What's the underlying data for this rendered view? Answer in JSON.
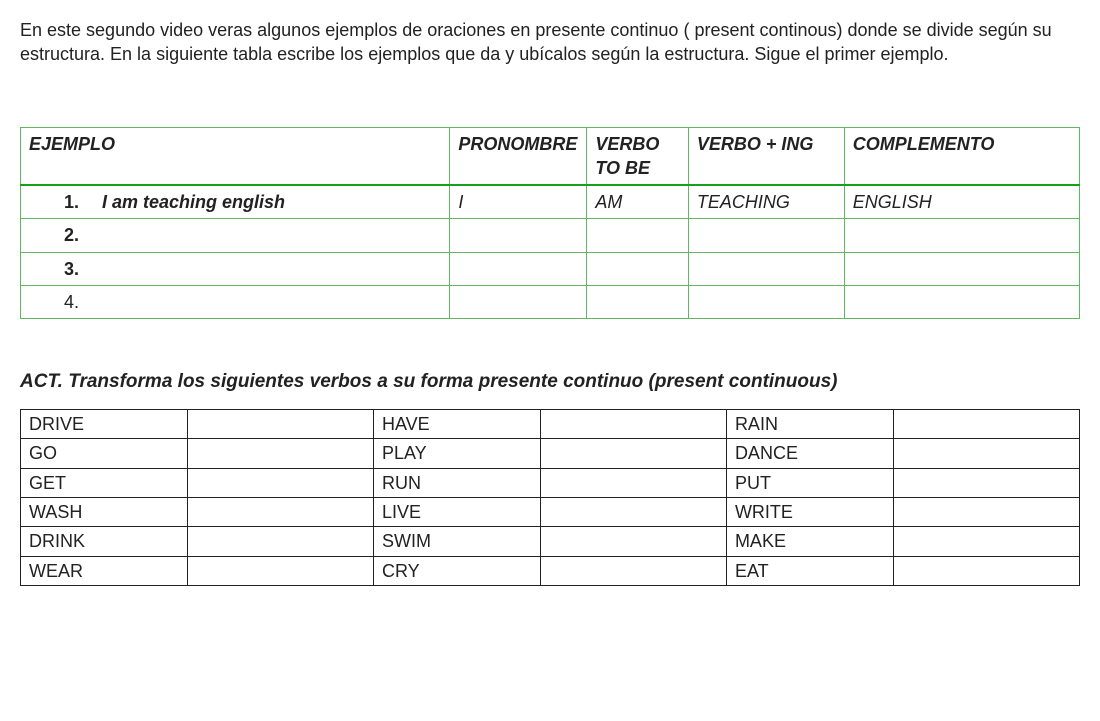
{
  "intro": "En este segundo video veras algunos ejemplos de oraciones en presente continuo ( present continous) donde se divide según su estructura. En la siguiente tabla escribe los ejemplos que da y ubícalos según la estructura. Sigue el primer ejemplo.",
  "ex_headers": {
    "ejemplo": "EJEMPLO",
    "pronombre": "PRONOMBRE",
    "tobe": "VERBO TO BE",
    "ing": "VERBO + ING",
    "complemento": "COMPLEMENTO"
  },
  "ex_rows": [
    {
      "num": "1.",
      "text": "I am teaching english",
      "pro": "I",
      "tobe": "AM",
      "ing": "TEACHING",
      "com": "ENGLISH"
    },
    {
      "num": "2.",
      "text": "",
      "pro": "",
      "tobe": "",
      "ing": "",
      "com": ""
    },
    {
      "num": "3.",
      "text": "",
      "pro": "",
      "tobe": "",
      "ing": "",
      "com": ""
    },
    {
      "num": "4.",
      "text": "",
      "pro": "",
      "tobe": "",
      "ing": "",
      "com": ""
    }
  ],
  "act_heading": "ACT. Transforma los siguientes verbos a su forma presente continuo (present continuous)",
  "verbs": {
    "col1": [
      "DRIVE",
      "GO",
      "GET",
      "WASH",
      "DRINK",
      "WEAR"
    ],
    "col2": [
      "HAVE",
      "PLAY",
      "RUN",
      "LIVE",
      "SWIM",
      "CRY"
    ],
    "col3": [
      "RAIN",
      "DANCE",
      "PUT",
      "WRITE",
      "MAKE",
      "EAT"
    ]
  }
}
